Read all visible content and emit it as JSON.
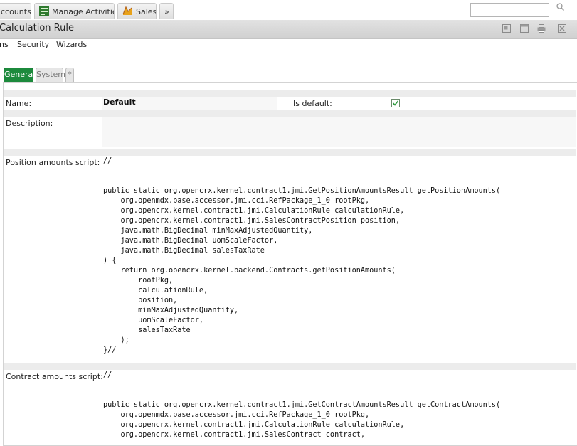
{
  "top_tabs": [
    {
      "label": "ccounts",
      "icon": ""
    },
    {
      "label": "Manage Activities",
      "icon": "activities-icon"
    },
    {
      "label": "Sales",
      "icon": "sales-icon"
    },
    {
      "label": "»",
      "icon": ""
    }
  ],
  "search": {
    "placeholder": "",
    "icon": "search-icon"
  },
  "page_title": "Calculation Rule",
  "window_icons": [
    "restore-icon",
    "maximize-icon",
    "print-icon",
    "close-icon"
  ],
  "menu": {
    "items": [
      "ns",
      "Security",
      "Wizards"
    ]
  },
  "form_tabs": [
    {
      "label": "General",
      "active": true
    },
    {
      "label": "System",
      "active": false
    },
    {
      "label": "*",
      "active": false
    }
  ],
  "fields": {
    "name_label": "Name:",
    "name_value": "Default",
    "is_default_label": "Is default:",
    "is_default_checked": true,
    "description_label": "Description:",
    "description_value": "",
    "position_script_label": "Position amounts script:",
    "position_script": "//\n\n\npublic static org.opencrx.kernel.contract1.jmi.GetPositionAmountsResult getPositionAmounts(\n    org.openmdx.base.accessor.jmi.cci.RefPackage_1_0 rootPkg,\n    org.opencrx.kernel.contract1.jmi.CalculationRule calculationRule,\n    org.opencrx.kernel.contract1.jmi.SalesContractPosition position,\n    java.math.BigDecimal minMaxAdjustedQuantity,\n    java.math.BigDecimal uomScaleFactor,\n    java.math.BigDecimal salesTaxRate\n) {\n    return org.opencrx.kernel.backend.Contracts.getPositionAmounts(\n        rootPkg,\n        calculationRule,\n        position,\n        minMaxAdjustedQuantity,\n        uomScaleFactor,\n        salesTaxRate\n    );\n}//",
    "contract_script_label": "Contract amounts script:",
    "contract_script": "//\n\n\npublic static org.opencrx.kernel.contract1.jmi.GetContractAmountsResult getContractAmounts(\n    org.openmdx.base.accessor.jmi.cci.RefPackage_1_0 rootPkg,\n    org.opencrx.kernel.contract1.jmi.CalculationRule calculationRule,\n    org.opencrx.kernel.contract1.jmi.SalesContract contract,"
  },
  "colors": {
    "active_tab": "#1c8a3c",
    "checkbox_mark": "#2e9b3e"
  }
}
